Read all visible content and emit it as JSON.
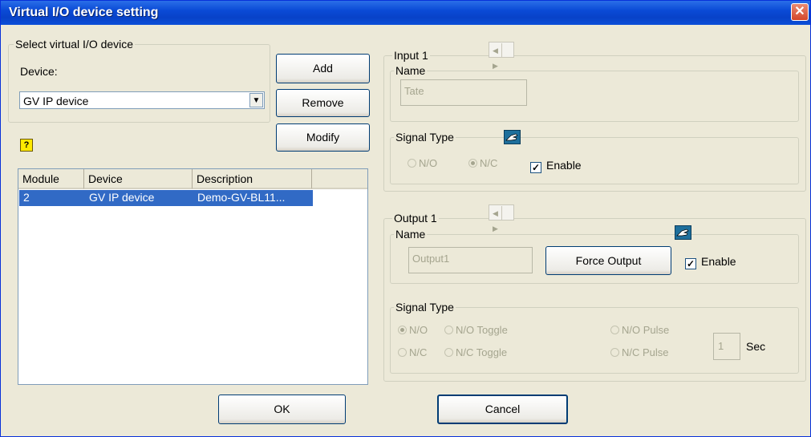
{
  "window": {
    "title": "Virtual I/O device setting"
  },
  "select_group": {
    "legend": "Select virtual I/O device",
    "device_label": "Device:",
    "device_value": "GV IP device"
  },
  "buttons": {
    "add": "Add",
    "remove": "Remove",
    "modify": "Modify",
    "ok": "OK",
    "cancel": "Cancel",
    "force_output": "Force Output"
  },
  "table": {
    "columns": [
      "Module",
      "Device",
      "Description"
    ],
    "rows": [
      {
        "module": "2",
        "device": "GV IP device",
        "description": "Demo-GV-BL11..."
      }
    ]
  },
  "input": {
    "legend": "Input 1",
    "name_legend": "Name",
    "name_value": "Tate",
    "signal_legend": "Signal Type",
    "radio_no": "N/O",
    "radio_nc": "N/C",
    "enable": "Enable"
  },
  "output": {
    "legend": "Output 1",
    "name_legend": "Name",
    "name_value": "Output1",
    "enable": "Enable",
    "signal_legend": "Signal Type",
    "radio_no": "N/O",
    "radio_no_toggle": "N/O Toggle",
    "radio_no_pulse": "N/O Pulse",
    "radio_nc": "N/C",
    "radio_nc_toggle": "N/C Toggle",
    "radio_nc_pulse": "N/C Pulse",
    "pulse_value": "1",
    "sec": "Sec"
  },
  "colors": {
    "titlebar": "#0a4ad6",
    "selection": "#316ac5",
    "dialog_bg": "#ece9d8"
  },
  "icons": {
    "help": "help-icon",
    "hand": "pointing-hand-icon",
    "close": "close-icon"
  }
}
